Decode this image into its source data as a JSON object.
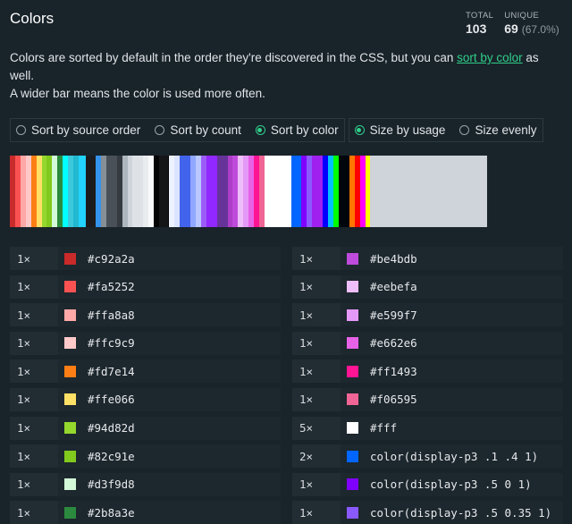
{
  "header": {
    "title": "Colors",
    "total_label": "TOTAL",
    "total": "103",
    "unique_label": "UNIQUE",
    "unique": "69",
    "unique_pct": "(67.0%)"
  },
  "description": {
    "line1_pre": "Colors are sorted by default in the order they're discovered in the CSS, but you can ",
    "link": "sort by color",
    "line1_post": " as well.",
    "line2": "A wider bar means the color is used more often."
  },
  "sort_options": [
    {
      "label": "Sort by source order",
      "selected": false
    },
    {
      "label": "Sort by count",
      "selected": false
    },
    {
      "label": "Sort by color",
      "selected": true
    }
  ],
  "size_options": [
    {
      "label": "Size by usage",
      "selected": true
    },
    {
      "label": "Size evenly",
      "selected": false
    }
  ],
  "accent": "#2fd08a",
  "bar": [
    [
      "#c92a2a",
      1
    ],
    [
      "#fa5252",
      1
    ],
    [
      "#ffa8a8",
      1
    ],
    [
      "#ffc9c9",
      1
    ],
    [
      "#fd7e14",
      1
    ],
    [
      "#ffe066",
      1
    ],
    [
      "#94d82d",
      1
    ],
    [
      "#82c91e",
      1
    ],
    [
      "#d3f9d8",
      1
    ],
    [
      "#2b8a3e",
      1
    ],
    [
      "#00ffff",
      1
    ],
    [
      "#3bc9db",
      1
    ],
    [
      "#22b8cf",
      1
    ],
    [
      "#22d3ff",
      1.3
    ],
    [
      "#1c1c1e",
      1.9
    ],
    [
      "#3393ed",
      1
    ],
    [
      "#868e96",
      1
    ],
    [
      "#495057",
      2
    ],
    [
      "#343a40",
      1
    ],
    [
      "#adb5bd",
      1
    ],
    [
      "#ced4da",
      1
    ],
    [
      "#dee2e6",
      2
    ],
    [
      "#e9ecef",
      1
    ],
    [
      "#f8f9fa",
      1
    ],
    [
      "#050505",
      1
    ],
    [
      "#151618",
      1.6
    ],
    [
      "#000000",
      0.3
    ],
    [
      "#edf2ff",
      1
    ],
    [
      "#dbe4ff",
      1
    ],
    [
      "#4263eb",
      2
    ],
    [
      "#91a7ff",
      1
    ],
    [
      "#bac8ff",
      1
    ],
    [
      "#9c5cfa",
      1
    ],
    [
      "#9028ff",
      2
    ],
    [
      "#663399",
      2
    ],
    [
      "#ae3ec9",
      1
    ],
    [
      "#be4bdb",
      1
    ],
    [
      "#eebefa",
      1
    ],
    [
      "#e599f7",
      1
    ],
    [
      "#e662e6",
      1
    ],
    [
      "#ff1493",
      1
    ],
    [
      "#f06595",
      1
    ],
    [
      "#ffffff",
      5
    ],
    [
      "#0066ff",
      2
    ],
    [
      "#8000ff",
      1
    ],
    [
      "#8a59ff",
      1
    ],
    [
      "#a020f0",
      2
    ],
    [
      "#0000ff",
      1
    ],
    [
      "#00bfff",
      1
    ],
    [
      "#00ff00",
      1
    ],
    [
      "#00060c",
      2
    ],
    [
      "#ff7700",
      1
    ],
    [
      "#ff0000",
      1
    ],
    [
      "#ff00ff",
      1
    ],
    [
      "#ffff00",
      1
    ],
    [
      "#ced4da",
      22
    ]
  ],
  "colors_left": [
    {
      "count": "1×",
      "value": "#c92a2a",
      "swatch": "#c92a2a"
    },
    {
      "count": "1×",
      "value": "#fa5252",
      "swatch": "#fa5252"
    },
    {
      "count": "1×",
      "value": "#ffa8a8",
      "swatch": "#ffa8a8"
    },
    {
      "count": "1×",
      "value": "#ffc9c9",
      "swatch": "#ffc9c9"
    },
    {
      "count": "1×",
      "value": "#fd7e14",
      "swatch": "#fd7e14"
    },
    {
      "count": "1×",
      "value": "#ffe066",
      "swatch": "#ffe066"
    },
    {
      "count": "1×",
      "value": "#94d82d",
      "swatch": "#94d82d"
    },
    {
      "count": "1×",
      "value": "#82c91e",
      "swatch": "#82c91e"
    },
    {
      "count": "1×",
      "value": "#d3f9d8",
      "swatch": "#d3f9d8"
    },
    {
      "count": "1×",
      "value": "#2b8a3e",
      "swatch": "#2b8a3e"
    }
  ],
  "colors_right": [
    {
      "count": "1×",
      "value": "#be4bdb",
      "swatch": "#be4bdb"
    },
    {
      "count": "1×",
      "value": "#eebefa",
      "swatch": "#eebefa"
    },
    {
      "count": "1×",
      "value": "#e599f7",
      "swatch": "#e599f7"
    },
    {
      "count": "1×",
      "value": "#e662e6",
      "swatch": "#e662e6"
    },
    {
      "count": "1×",
      "value": "#ff1493",
      "swatch": "#ff1493"
    },
    {
      "count": "1×",
      "value": "#f06595",
      "swatch": "#f06595"
    },
    {
      "count": "5×",
      "value": "#fff",
      "swatch": "#ffffff"
    },
    {
      "count": "2×",
      "value": "color(display-p3 .1 .4 1)",
      "swatch": "#0066ff"
    },
    {
      "count": "1×",
      "value": "color(display-p3 .5 0 1)",
      "swatch": "#8000ff"
    },
    {
      "count": "1×",
      "value": "color(display-p3 .5 0.35 1)",
      "swatch": "#8a59ff"
    }
  ]
}
